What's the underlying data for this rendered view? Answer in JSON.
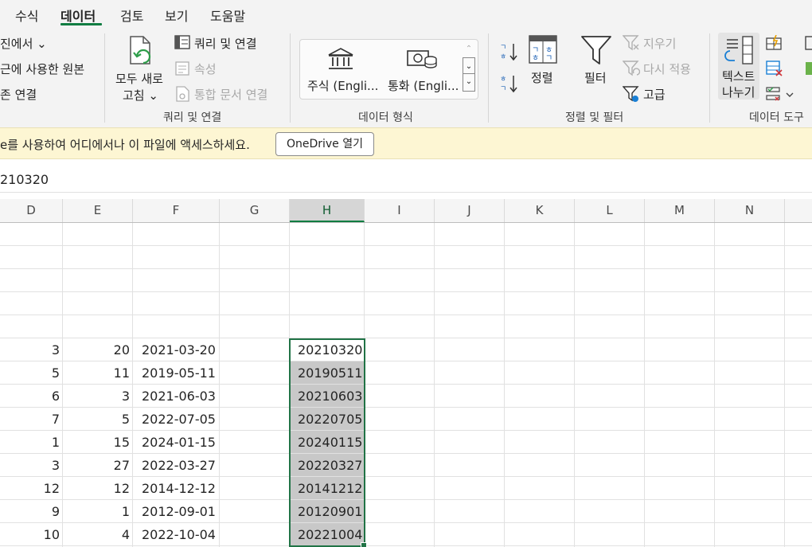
{
  "tabs": [
    "수식",
    "데이터",
    "검토",
    "보기",
    "도움말"
  ],
  "active_tab": "데이터",
  "ribbon": {
    "get_data": {
      "items": [
        "진에서 ⌄",
        "근에 사용한 원본",
        "존 연결"
      ]
    },
    "queries": {
      "refresh_all_line1": "모두 새로",
      "refresh_all_line2": "고침 ⌄",
      "queries_connections": "쿼리 및 연결",
      "properties": "속성",
      "edit_links": "통합 문서 연결",
      "group_label": "쿼리 및 연결"
    },
    "data_types": {
      "stocks": "주식 (Engli...",
      "currencies": "통화 (Engli...",
      "group_label": "데이터 형식"
    },
    "sort_filter": {
      "sort": "정렬",
      "filter": "필터",
      "clear": "지우기",
      "reapply": "다시 적용",
      "advanced": "고급",
      "group_label": "정렬 및 필터"
    },
    "data_tools": {
      "text_to_columns_line1": "텍스트",
      "text_to_columns_line2": "나누기",
      "group_label": "데이터 도구"
    }
  },
  "message_bar": {
    "text": "e를 사용하여 어디에서나 이 파일에 액세스하세요.",
    "button": "OneDrive 열기"
  },
  "formula_bar": {
    "value": "210320"
  },
  "columns": [
    "D",
    "E",
    "F",
    "G",
    "H",
    "I",
    "J",
    "K",
    "L",
    "M",
    "N"
  ],
  "selected_column": "H",
  "rows": [
    {
      "D": "3",
      "E": "20",
      "F": "2021-03-20",
      "H": "20210320"
    },
    {
      "D": "5",
      "E": "11",
      "F": "2019-05-11",
      "H": "20190511"
    },
    {
      "D": "6",
      "E": "3",
      "F": "2021-06-03",
      "H": "20210603"
    },
    {
      "D": "7",
      "E": "5",
      "F": "2022-07-05",
      "H": "20220705"
    },
    {
      "D": "1",
      "E": "15",
      "F": "2024-01-15",
      "H": "20240115"
    },
    {
      "D": "3",
      "E": "27",
      "F": "2022-03-27",
      "H": "20220327"
    },
    {
      "D": "12",
      "E": "12",
      "F": "2014-12-12",
      "H": "20141212"
    },
    {
      "D": "9",
      "E": "1",
      "F": "2012-09-01",
      "H": "20120901"
    },
    {
      "D": "10",
      "E": "4",
      "F": "2022-10-04",
      "H": "20221004"
    }
  ],
  "colors": {
    "accent": "#107c41",
    "selection_border": "#217346",
    "selection_fill": "#c8c8c8"
  }
}
